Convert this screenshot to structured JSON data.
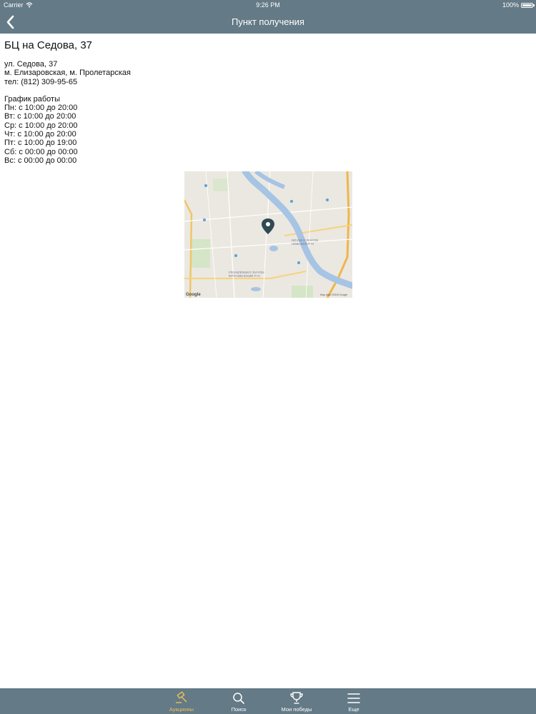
{
  "status": {
    "carrier": "Carrier",
    "time": "9:26 PM",
    "battery": "100%"
  },
  "nav": {
    "title": "Пункт получения",
    "back_icon": "chevron-left-icon"
  },
  "location": {
    "name": "БЦ на Седова, 37",
    "address": "ул. Седова, 37",
    "metro": "м. Елизаровская, м. Пролетарская",
    "phone": "тел: (812) 309-95-65"
  },
  "schedule": {
    "heading": "График работы",
    "days": [
      "Пн: с 10:00 до 20:00",
      "Вт: с 10:00 до 20:00",
      "Ср: с 10:00 до 20:00",
      "Чт: с 10:00 до 20:00",
      "Пт: с 10:00 до 19:00",
      "Сб: с 00:00 до 00:00",
      "Вс: с 00:00 до 00:00"
    ]
  },
  "map": {
    "district_latin": "NEVSKIY RAYON",
    "district": "НЕВСКИЙ Р-Н",
    "district2_latin": "FRUNZENSKIY RAYON",
    "district2": "ФРУНЗЕНСКИЙ Р-Н",
    "attribution": "Map data ©2016 Google",
    "logo": "Google"
  },
  "tabs": [
    {
      "label": "Аукционы",
      "icon": "gavel-icon",
      "active": true
    },
    {
      "label": "Поиск",
      "icon": "search-icon",
      "active": false
    },
    {
      "label": "Мои победы",
      "icon": "trophy-icon",
      "active": false
    },
    {
      "label": "Еще",
      "icon": "menu-icon",
      "active": false
    }
  ],
  "colors": {
    "bar": "#647a86",
    "accent": "#e8c25a",
    "river": "#a6c4e4",
    "pin": "#2f4a52"
  }
}
